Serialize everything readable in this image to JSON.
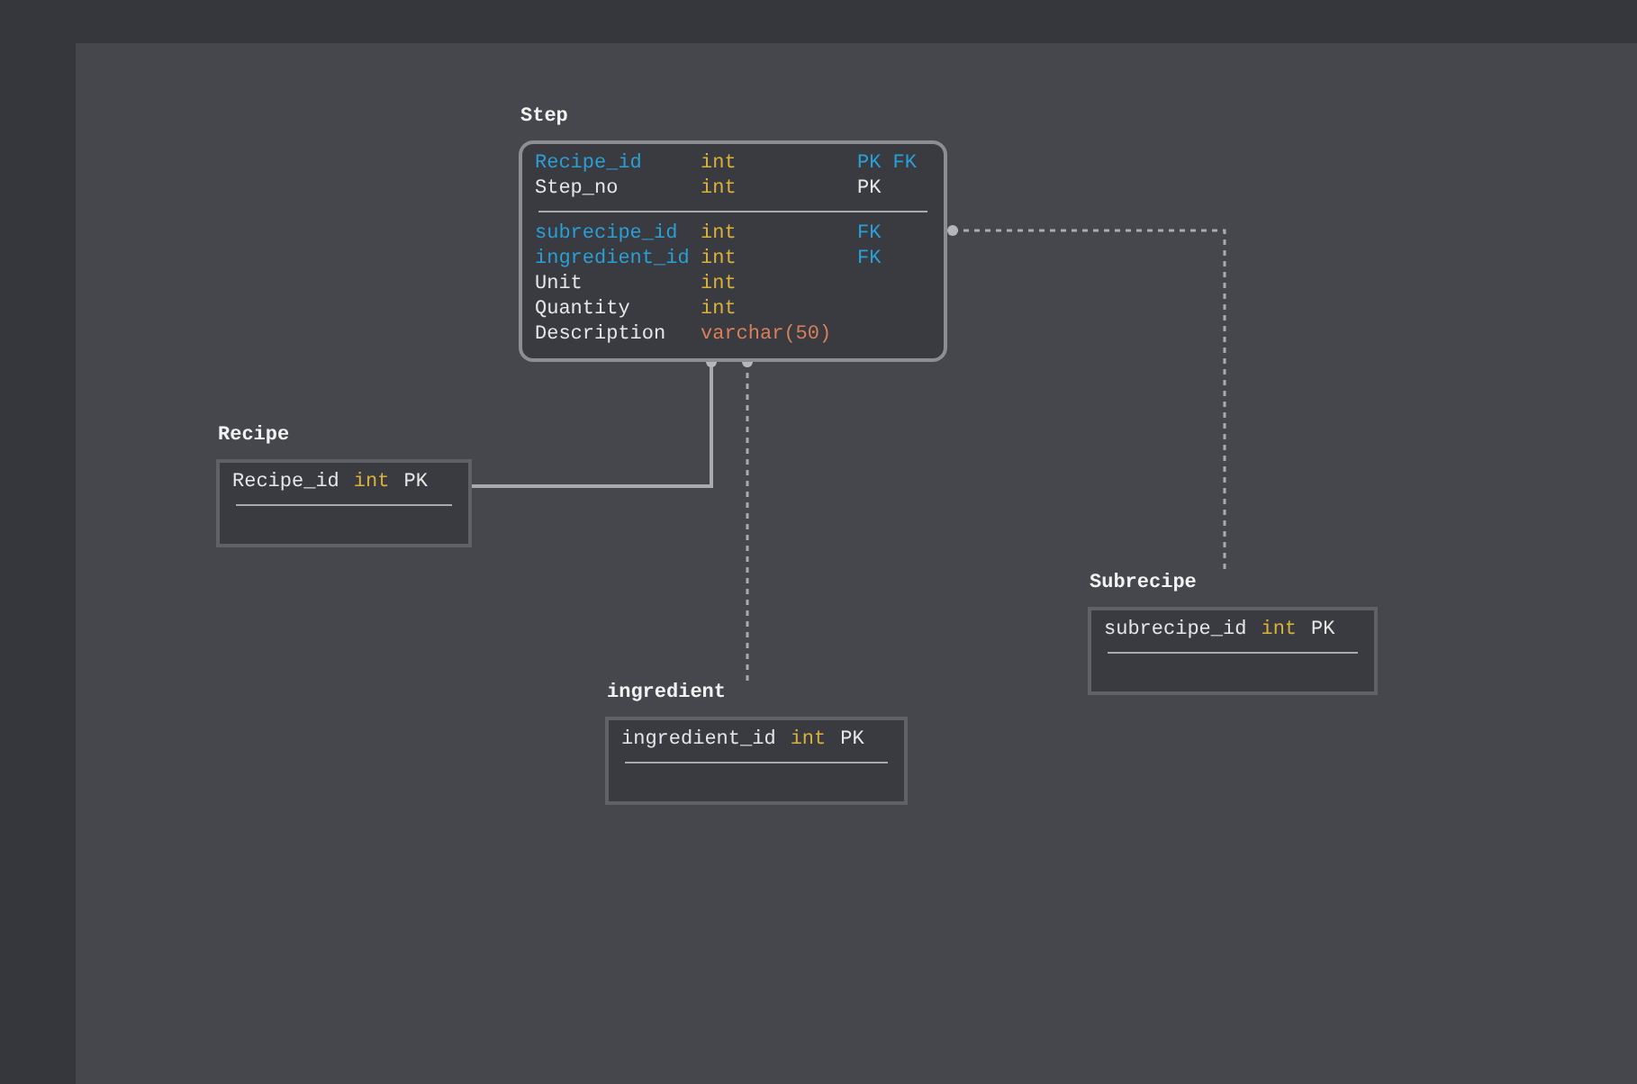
{
  "tables": [
    {
      "title": "Step",
      "rounded": true,
      "key_fields": [
        {
          "name": "Recipe_id",
          "type": "int",
          "kind": "numeric",
          "key": "PK FK",
          "foreign": true
        },
        {
          "name": "Step_no",
          "type": "int",
          "kind": "numeric",
          "key": "PK",
          "foreign": false
        }
      ],
      "fields": [
        {
          "name": "subrecipe_id",
          "type": "int",
          "kind": "numeric",
          "key": "FK",
          "foreign": true
        },
        {
          "name": "ingredient_id",
          "type": "int",
          "kind": "numeric",
          "key": "FK",
          "foreign": true
        },
        {
          "name": "Unit",
          "type": "int",
          "kind": "numeric",
          "foreign": false
        },
        {
          "name": "Quantity",
          "type": "int",
          "kind": "numeric",
          "foreign": false
        },
        {
          "name": "Description",
          "type": "varchar(50)",
          "kind": "string",
          "foreign": false
        }
      ]
    },
    {
      "title": "Recipe",
      "rounded": false,
      "key_fields": [
        {
          "name": "Recipe_id",
          "type": "int",
          "kind": "numeric",
          "key": "PK",
          "foreign": false
        }
      ]
    },
    {
      "title": "ingredient",
      "rounded": false,
      "key_fields": [
        {
          "name": "ingredient_id",
          "type": "int",
          "kind": "numeric",
          "key": "PK",
          "foreign": false
        }
      ]
    },
    {
      "title": "Subrecipe",
      "rounded": false,
      "key_fields": [
        {
          "name": "subrecipe_id",
          "type": "int",
          "kind": "numeric",
          "key": "PK",
          "foreign": false
        }
      ]
    }
  ]
}
